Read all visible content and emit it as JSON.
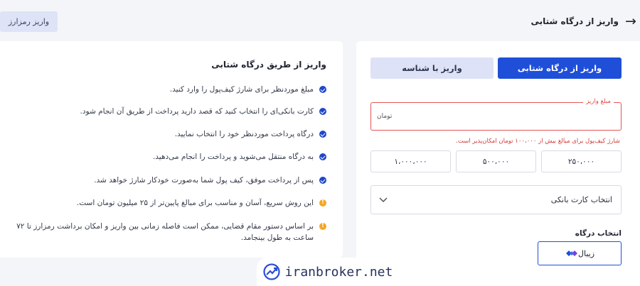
{
  "header": {
    "title": "واریز از درگاه شتابی",
    "crypto_button": "واریز رمزارز"
  },
  "info": {
    "title": "واریز از طریق درگاه شتابی",
    "items": [
      "مبلغ موردنظر برای شارژ کیف‌پول را وارد کنید.",
      "کارت بانکی‌ای را انتخاب کنید که قصد دارید پرداخت از طریق آن انجام شود.",
      "درگاه پرداخت موردنظر خود را انتخاب نمایید.",
      "به درگاه منتقل می‌شوید و پرداخت را انجام می‌دهید.",
      "پس از پرداخت موفق، کیف پول شما به‌صورت خودکار شارژ خواهد شد.",
      "این روش سریع، آسان و مناسب برای مبالغ پایین‌تر از ۲۵ میلیون تومان است.",
      "بر اساس دستور مقام قضایی، ممکن است فاصله زمانی بین واریز و امکان برداشت رمزارز تا ۷۲ ساعت به طول بینجامد."
    ]
  },
  "tabs": {
    "gateway": "واریز از درگاه شتابی",
    "by_id": "واریز با شناسه"
  },
  "amount": {
    "label": "مبلغ واریز",
    "placeholder": "تومان",
    "error": "شارژ کیف‌پول برای مبالغ بیش از ۱۰۰،۰۰۰ تومان امکان‌پذیر است."
  },
  "presets": [
    "۱،۰۰۰،۰۰۰",
    "۵۰۰،۰۰۰",
    "۲۵۰،۰۰۰"
  ],
  "card_select": {
    "placeholder": "انتخاب کارت بانکی"
  },
  "gateway": {
    "label": "انتخاب درگاه",
    "option": "زیبال"
  },
  "watermark": {
    "text": "iranbroker.net"
  },
  "colors": {
    "primary": "#1f4fd8",
    "error": "#e55656",
    "warning": "#f5a623"
  }
}
